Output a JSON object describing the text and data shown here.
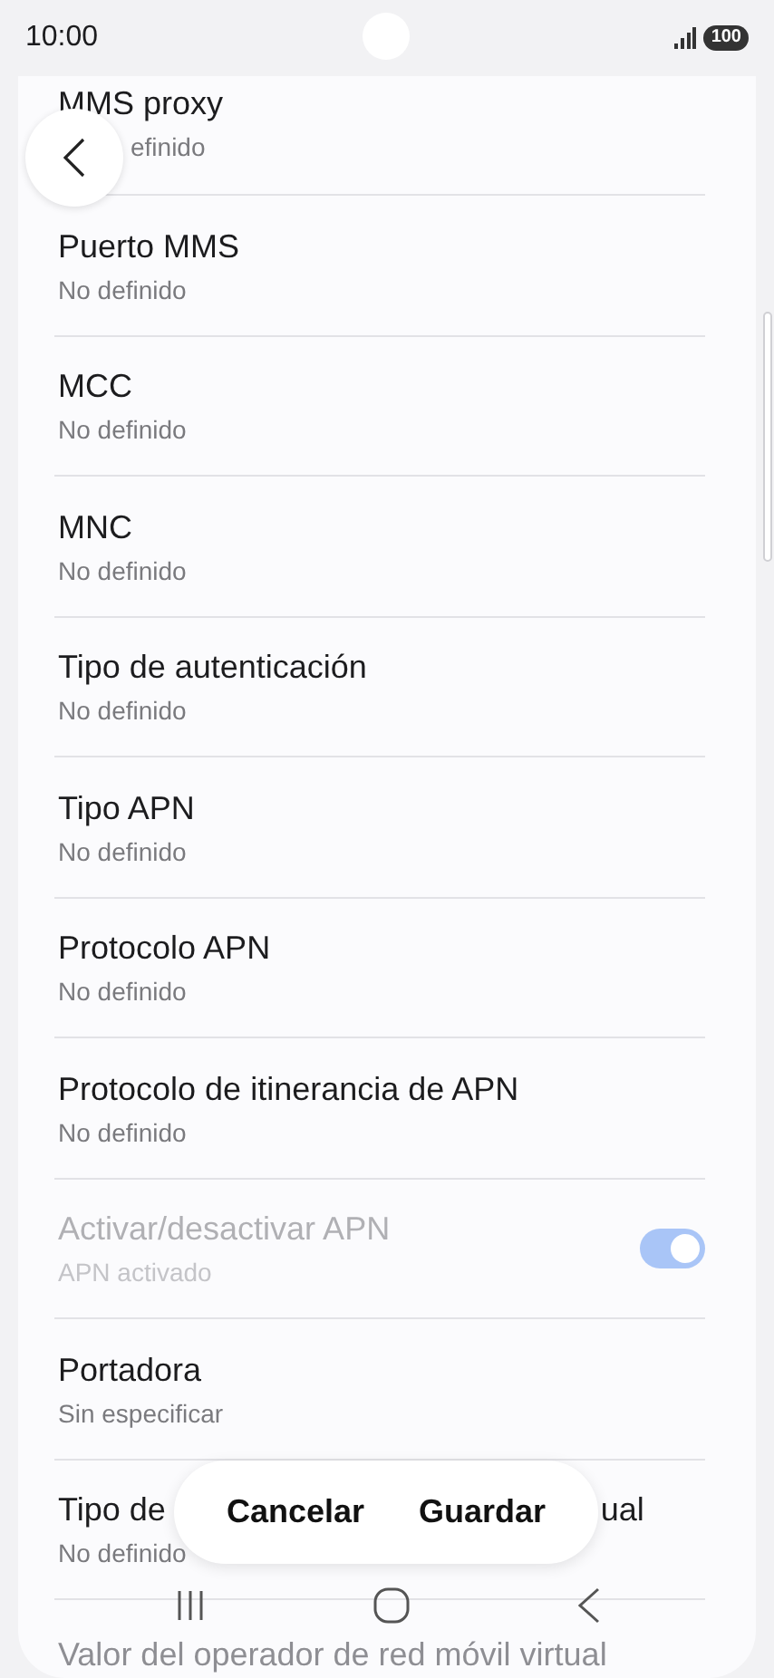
{
  "status_bar": {
    "time": "10:00",
    "battery": "100"
  },
  "rows": [
    {
      "kind": "text",
      "title": "MMS proxy",
      "subtitle": "efinido"
    },
    {
      "kind": "text",
      "title": "Puerto MMS",
      "subtitle": "No definido"
    },
    {
      "kind": "text",
      "title": "MCC",
      "subtitle": "No definido"
    },
    {
      "kind": "text",
      "title": "MNC",
      "subtitle": "No definido"
    },
    {
      "kind": "text",
      "title": "Tipo de autenticación",
      "subtitle": "No definido"
    },
    {
      "kind": "text",
      "title": "Tipo APN",
      "subtitle": "No definido"
    },
    {
      "kind": "text",
      "title": "Protocolo APN",
      "subtitle": "No definido"
    },
    {
      "kind": "text",
      "title": "Protocolo de itinerancia de APN",
      "subtitle": "No definido"
    },
    {
      "kind": "toggle",
      "title": "Activar/desactivar APN",
      "subtitle": "APN activado",
      "disabled": true,
      "on": true
    },
    {
      "kind": "text",
      "title": "Portadora",
      "subtitle": "Sin especificar"
    },
    {
      "kind": "covered",
      "title_parts": [
        "Tipo de",
        "ual"
      ],
      "subtitle": "No definido"
    },
    {
      "kind": "text",
      "title": "Valor del operador de red móvil virtual"
    }
  ],
  "actions": [
    {
      "label": "Cancelar"
    },
    {
      "label": "Guardar"
    }
  ]
}
